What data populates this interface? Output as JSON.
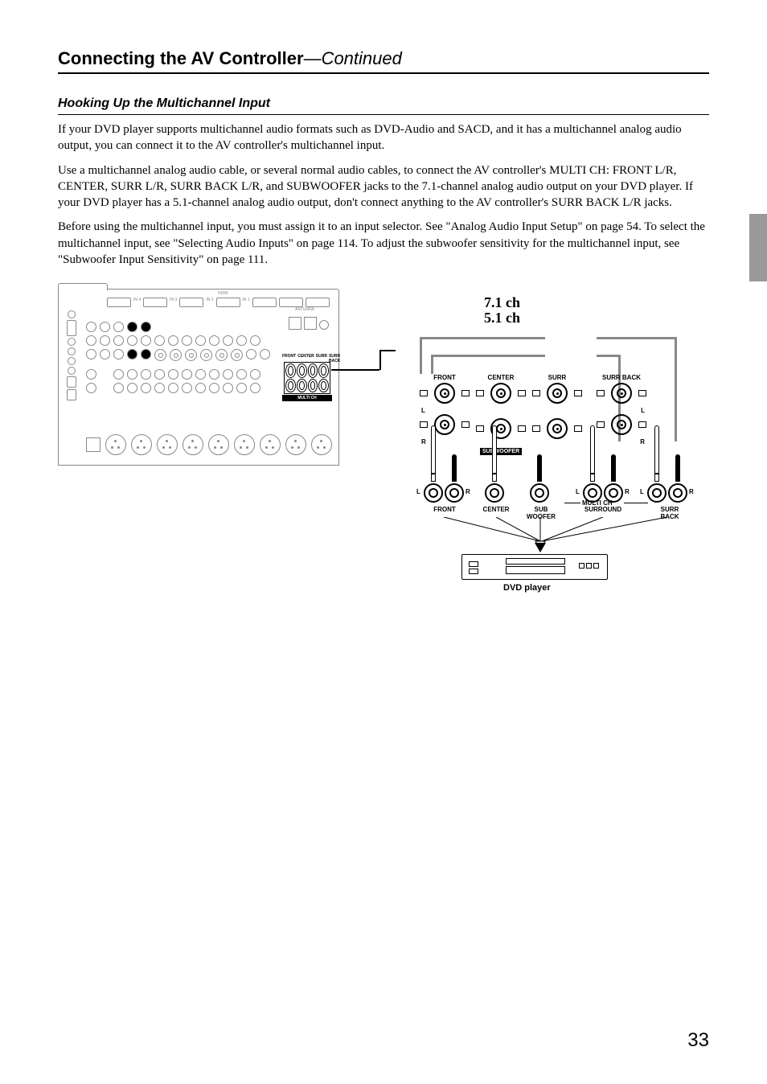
{
  "header": {
    "title_bold": "Connecting the AV Controller",
    "title_italic": "—Continued"
  },
  "section": {
    "h2": "Hooking Up the Multichannel Input",
    "p1": "If your DVD player supports multichannel audio formats such as DVD-Audio and SACD, and it has a multichannel analog audio output, you can connect it to the AV controller's multichannel input.",
    "p2": "Use a multichannel analog audio cable, or several normal audio cables, to connect the AV controller's MULTI CH: FRONT L/R, CENTER, SURR L/R, SURR BACK L/R, and SUBWOOFER jacks to the 7.1-channel analog audio output on your DVD player. If your DVD player has a 5.1-channel analog audio output, don't connect anything to the AV controller's SURR BACK L/R jacks.",
    "p3": "Before using the multichannel input, you must assign it to an input selector. See \"Analog Audio Input Setup\" on page 54. To select the multichannel input, see \"Selecting Audio Inputs\" on page 114. To adjust the subwoofer sensitivity for the multichannel input, see \"Subwoofer Input Sensitivity\" on page 111."
  },
  "diagram": {
    "ch71": "7.1 ch",
    "ch51": "5.1 ch",
    "jacks": {
      "front": "FRONT",
      "center": "CENTER",
      "surr": "SURR",
      "surr_back": "SURR BACK",
      "subwoofer": "SUBWOOFER",
      "multi_ch": "MULTI CH",
      "L": "L",
      "R": "R"
    },
    "plugs": {
      "front": "FRONT",
      "center": "CENTER",
      "sub": "SUB\nWOOFER",
      "surround": "SURROUND",
      "surr_back": "SURR\nBACK",
      "L": "L",
      "R": "R"
    },
    "panel": {
      "hdmi": "HDMI",
      "antenna": "ANTENNA",
      "mc_front": "FRONT",
      "mc_center": "CENTER",
      "mc_surr": "SURR",
      "mc_surrback": "SURR BACK",
      "mc_bar": "MULTI CH"
    },
    "dvd_label": "DVD player"
  },
  "page_number": "33"
}
